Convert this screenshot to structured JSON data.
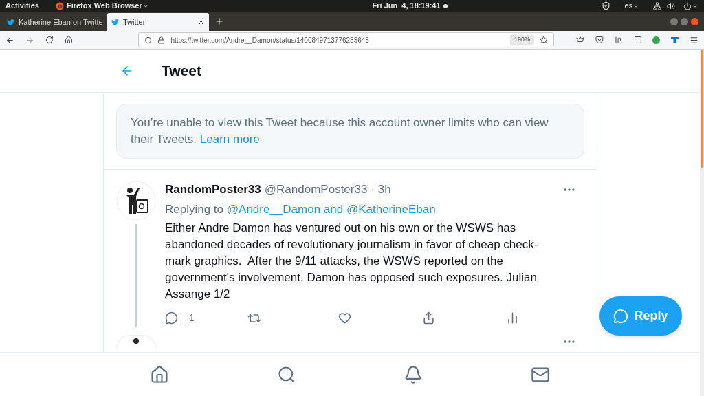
{
  "system_bar": {
    "activities": "Activities",
    "app_menu": "Firefox Web Browser",
    "clock": "Fri Jun  4, 18:19:41",
    "language": "es"
  },
  "tabs": [
    {
      "title": "Katherine Eban on Twitte",
      "selected": false
    },
    {
      "title": "Twitter",
      "selected": true
    }
  ],
  "toolbar": {
    "url": "https://twitter.com/Andre__Damon/status/1400849713776283648",
    "zoom": "190%"
  },
  "page": {
    "title": "Tweet",
    "notice": {
      "text": "You’re unable to view this Tweet because this account owner limits who can view their Tweets.",
      "link": "Learn more"
    },
    "tweets": [
      {
        "name": "RandomPoster33",
        "handle": "@RandomPoster33",
        "time": "· 3h",
        "replying_label": "Replying to",
        "replying_targets": "@Andre__Damon and @KatherineEban",
        "body": "Either Andre Damon has ventured out on his own or the WSWS has abandoned decades of revolutionary journalism in favor of cheap check-mark graphics.  After the 9/11 attacks, the WSWS reported on the government's involvement. Damon has opposed such exposures. Julian Assange 1/2",
        "reply_count": "1"
      }
    ],
    "reply_button": "Reply"
  }
}
